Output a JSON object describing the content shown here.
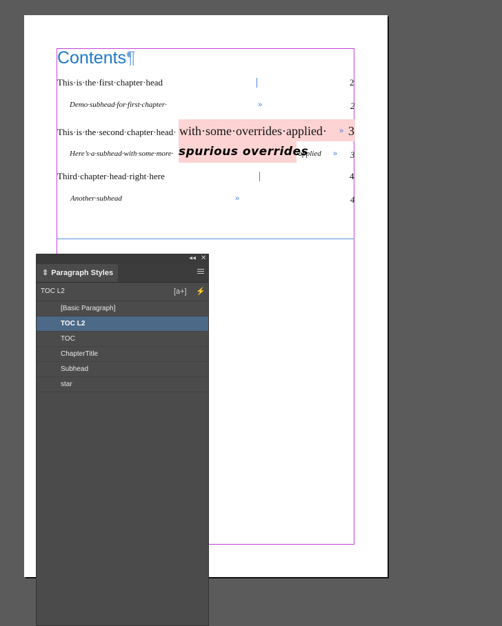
{
  "document": {
    "title": "Contents",
    "pilcrow": "¶",
    "tab_mark": "»",
    "entries": [
      {
        "text": "This·is·the·first·chapter·head",
        "page": "2"
      },
      {
        "text": "Demo·subhead·for·first·chapter·",
        "page": "2"
      },
      {
        "text_start": "This·is·the·second·chapter·head·",
        "text_override": "with·some·overrides·applied·",
        "page": "3"
      },
      {
        "text_start": "Here’s·a·subhead·with·some·more·",
        "text_override": "spurious overrides",
        "text_end": "·applied",
        "page": "3"
      },
      {
        "text": "Third·chapter·head·right·here",
        "page": "4"
      },
      {
        "text": "Another·subhead",
        "page": "4"
      }
    ]
  },
  "panel": {
    "collapse_icon": "◂◂",
    "close_icon": "✕",
    "tab_label": "Paragraph Styles",
    "current_style": "TOC L2",
    "new_style_icon": "[a+]",
    "quick_apply_icon": "⚡",
    "styles": [
      "[Basic Paragraph]",
      "TOC L2",
      "TOC",
      "ChapterTitle",
      "Subhead",
      "star"
    ],
    "selected_style": "TOC L2"
  },
  "colors": {
    "frame": "#c23fd8",
    "title": "#1f78c8",
    "override_highlight": "#fdd3d3",
    "selection": "#4c6987"
  }
}
